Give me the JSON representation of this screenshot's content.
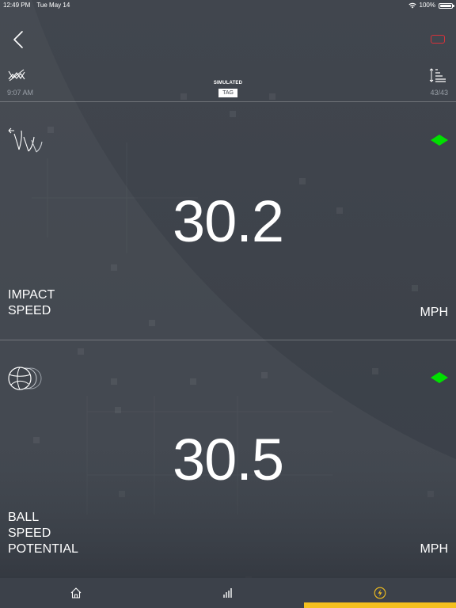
{
  "status_bar": {
    "time": "12:49 PM",
    "date": "Tue May 14",
    "battery": "100%"
  },
  "header": {
    "time": "9:07 AM",
    "mode": "SIMULATED",
    "tag_label": "TAG",
    "count": "43/43"
  },
  "metrics": [
    {
      "value": "30.2",
      "label_lines": [
        "IMPACT",
        "SPEED"
      ],
      "unit": "MPH",
      "icon": "hand-swing-icon",
      "indicator_color": "#00e000"
    },
    {
      "value": "30.5",
      "label_lines": [
        "BALL",
        "SPEED",
        "POTENTIAL"
      ],
      "unit": "MPH",
      "icon": "volleyball-icon",
      "indicator_color": "#00e000"
    }
  ],
  "tabs": [
    {
      "icon": "home-icon",
      "active": false
    },
    {
      "icon": "bar-chart-icon",
      "active": false
    },
    {
      "icon": "bolt-icon",
      "active": true
    }
  ],
  "colors": {
    "accent": "#f4c01e",
    "indicator": "#00e000",
    "device_outline": "#d8313a",
    "background": "#3b4048"
  }
}
